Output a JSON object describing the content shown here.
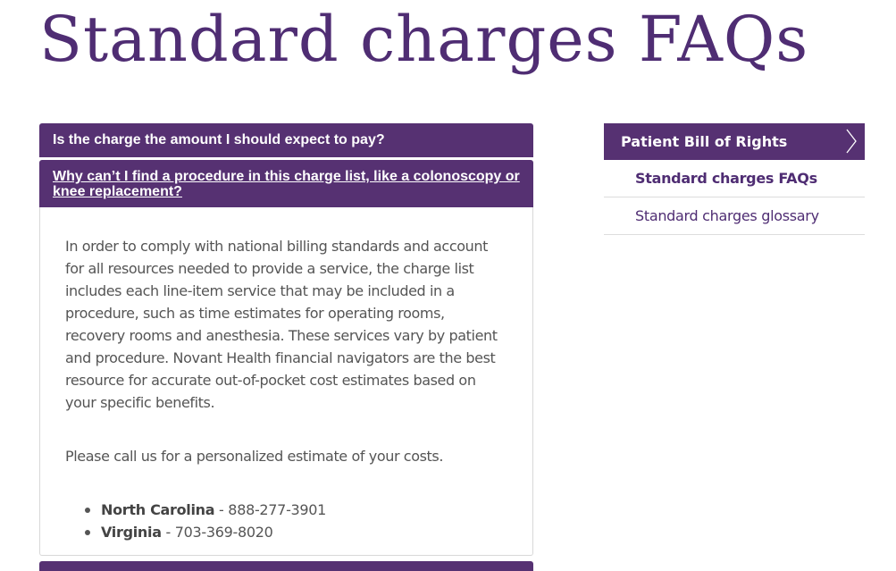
{
  "page": {
    "title": "Standard charges FAQs"
  },
  "faq": {
    "items": [
      {
        "question": "Is the charge the amount I should expect to pay?"
      },
      {
        "question": "Why can’t I find a procedure in this charge list, like a colonoscopy or knee replacement?"
      }
    ],
    "open_answer": {
      "paragraph_1": "In order to comply with national billing standards and account for all resources needed to provide a service, the charge list includes each line-item service that may be included in a procedure, such as time estimates for operating rooms, recovery rooms and anesthesia. These services vary by patient and procedure. Novant Health financial navigators are the best resource for accurate out-of-pocket cost estimates based on your specific benefits.",
      "paragraph_2": "Please call us for a personalized estimate of your costs.",
      "contacts": [
        {
          "region": "North Carolina",
          "phone": " - 888-277-3901"
        },
        {
          "region": "Virginia",
          "phone": " - 703-369-8020"
        }
      ]
    }
  },
  "sidebar": {
    "header": "Patient Bill of Rights",
    "header_icon": "chevron-right-icon",
    "items": [
      {
        "label": "Standard charges FAQs",
        "active": true
      },
      {
        "label": "Standard charges glossary",
        "active": false
      }
    ]
  },
  "colors": {
    "brand_purple": "#563172",
    "title_purple": "#4f2d73",
    "body_text": "#555555"
  }
}
